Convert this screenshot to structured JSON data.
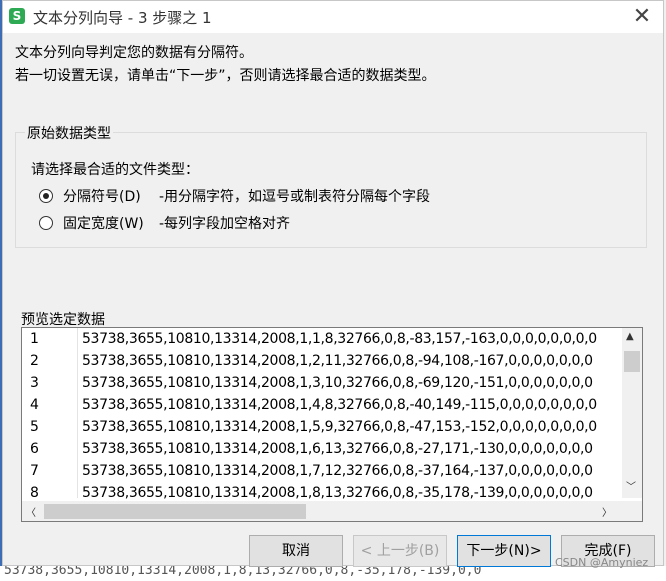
{
  "window": {
    "title": "文本分列向导 - 3 步骤之 1",
    "app_icon_letter": "S",
    "close_glyph": "✕"
  },
  "intro": {
    "line1": "文本分列向导判定您的数据有分隔符。",
    "line2": "若一切设置无误，请单击“下一步”，否则请选择最合适的数据类型。"
  },
  "original_type": {
    "group_title": "原始数据类型",
    "prompt": "请选择最合适的文件类型：",
    "options": [
      {
        "label": "分隔符号(D)",
        "description": "-用分隔字符，如逗号或制表符分隔每个字段",
        "selected": true
      },
      {
        "label": "固定宽度(W)",
        "description": "-每列字段加空格对齐",
        "selected": false
      }
    ]
  },
  "preview": {
    "title": "预览选定数据",
    "rows": [
      {
        "num": "1",
        "text": "53738,3655,10810,13314,2008,1,1,8,32766,0,8,-83,157,-163,0,0,0,0,0,0,0,0"
      },
      {
        "num": "2",
        "text": "53738,3655,10810,13314,2008,1,2,11,32766,0,8,-94,108,-167,0,0,0,0,0,0,0"
      },
      {
        "num": "3",
        "text": "53738,3655,10810,13314,2008,1,3,10,32766,0,8,-69,120,-151,0,0,0,0,0,0,0"
      },
      {
        "num": "4",
        "text": "53738,3655,10810,13314,2008,1,4,8,32766,0,8,-40,149,-115,0,0,0,0,0,0,0,0"
      },
      {
        "num": "5",
        "text": "53738,3655,10810,13314,2008,1,5,9,32766,0,8,-47,153,-152,0,0,0,0,0,0,0,0"
      },
      {
        "num": "6",
        "text": "53738,3655,10810,13314,2008,1,6,13,32766,0,8,-27,171,-130,0,0,0,0,0,0,0"
      },
      {
        "num": "7",
        "text": "53738,3655,10810,13314,2008,1,7,12,32766,0,8,-37,164,-137,0,0,0,0,0,0,0"
      },
      {
        "num": "8",
        "text": "53738,3655,10810,13314,2008,1,8,13,32766,0,8,-35,178,-139,0,0,0,0,0,0,0"
      }
    ],
    "scroll_up": "▲",
    "scroll_down": "﹀",
    "scroll_left": "〈",
    "scroll_right": "〉"
  },
  "buttons": {
    "cancel": "取消",
    "back": "< 上一步(B)",
    "next": "下一步(N)>",
    "finish": "完成(F)"
  },
  "watermark": "CSDN @Amyniez",
  "background_strip": "53738,3655,10810,13314,2008,1,8,13,32766,0,8,-35,178,-139,0,0"
}
